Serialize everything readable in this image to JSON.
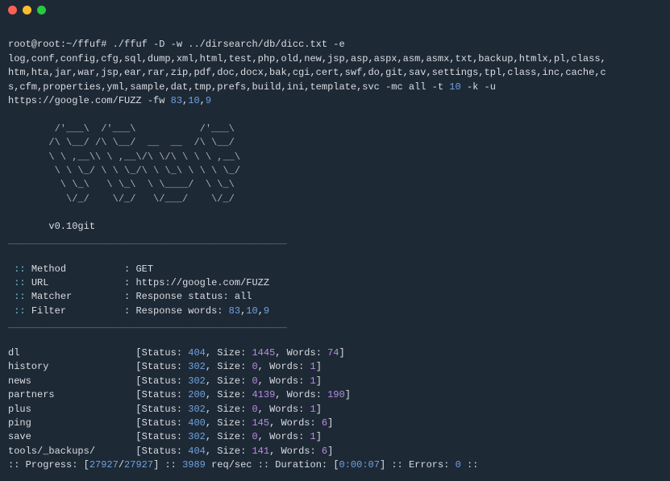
{
  "prompt": {
    "user_host": "root@root",
    "cwd": "~/ffuf",
    "symbol": "#",
    "cmd": "./ffuf -D -w ../dirsearch/db/dicc.txt -e",
    "ext_line1": "log,conf,config,cfg,sql,dump,xml,html,test,php,old,new,jsp,asp,aspx,asm,asmx,txt,backup,htmlx,pl,class,",
    "ext_line2": "htm,hta,jar,war,jsp,ear,rar,zip,pdf,doc,docx,bak,cgi,cert,swf,do,git,sav,settings,tpl,class,inc,cache,c",
    "ext_line3_a": "s,cfm,properties,yml,sample,dat,tmp,prefs,build,ini,template,svc -mc all -t ",
    "ext_line3_t": "10",
    "ext_line3_b": " -k -u",
    "url_line_a": "https://google.com/FUZZ -fw ",
    "fw1": "83",
    "fw2": "10",
    "fw3": "9"
  },
  "ascii": {
    "l1": "        /'___\\  /'___\\           /'___\\",
    "l2a": "       /\\ \\__/ /\\ \\__/  __  __  /\\ \\__/",
    "l3": "       \\ \\ ,__\\\\ \\ ,__\\/\\ \\/\\ \\ \\ \\ ,__\\",
    "l4a": "        \\ \\ \\_/ \\ \\ \\_/\\ \\ \\_\\ \\ \\ \\ \\_/",
    "l5": "         \\ \\_\\   \\ \\_\\  \\ \\____/  \\ \\_\\",
    "l6": "          \\/_/    \\/_/   \\/___/    \\/_/"
  },
  "version": "       v0.10git",
  "divider": "________________________________________________",
  "config": {
    "method_lbl": "Method",
    "method_val": "GET",
    "url_lbl": "URL",
    "url_val": "https://google.com/FUZZ",
    "matcher_lbl": "Matcher",
    "matcher_val": "Response status: all",
    "filter_lbl": "Filter",
    "filter_val_a": "Response words: ",
    "filter_n1": "83",
    "filter_n2": "10",
    "filter_n3": "9"
  },
  "results": [
    {
      "path": "dl",
      "status": "404",
      "size": "1445",
      "words": "74"
    },
    {
      "path": "history",
      "status": "302",
      "size": "0",
      "words": "1"
    },
    {
      "path": "news",
      "status": "302",
      "size": "0",
      "words": "1"
    },
    {
      "path": "partners",
      "status": "200",
      "size": "4139",
      "words": "190"
    },
    {
      "path": "plus",
      "status": "302",
      "size": "0",
      "words": "1"
    },
    {
      "path": "ping",
      "status": "400",
      "size": "145",
      "words": "6"
    },
    {
      "path": "save",
      "status": "302",
      "size": "0",
      "words": "1"
    },
    {
      "path": "tools/_backups/",
      "status": "404",
      "size": "141",
      "words": "6"
    }
  ],
  "footer": {
    "progress_lbl": ":: Progress: [",
    "prog_a": "27927",
    "prog_sep": "/",
    "prog_b": "27927",
    "progress_end": "] :: ",
    "rate": "3989",
    "rate_lbl": " req/sec :: Duration: [",
    "dur": "0:00:07",
    "dur_end": "] :: Errors: ",
    "errors": "0",
    "tail": " ::"
  }
}
